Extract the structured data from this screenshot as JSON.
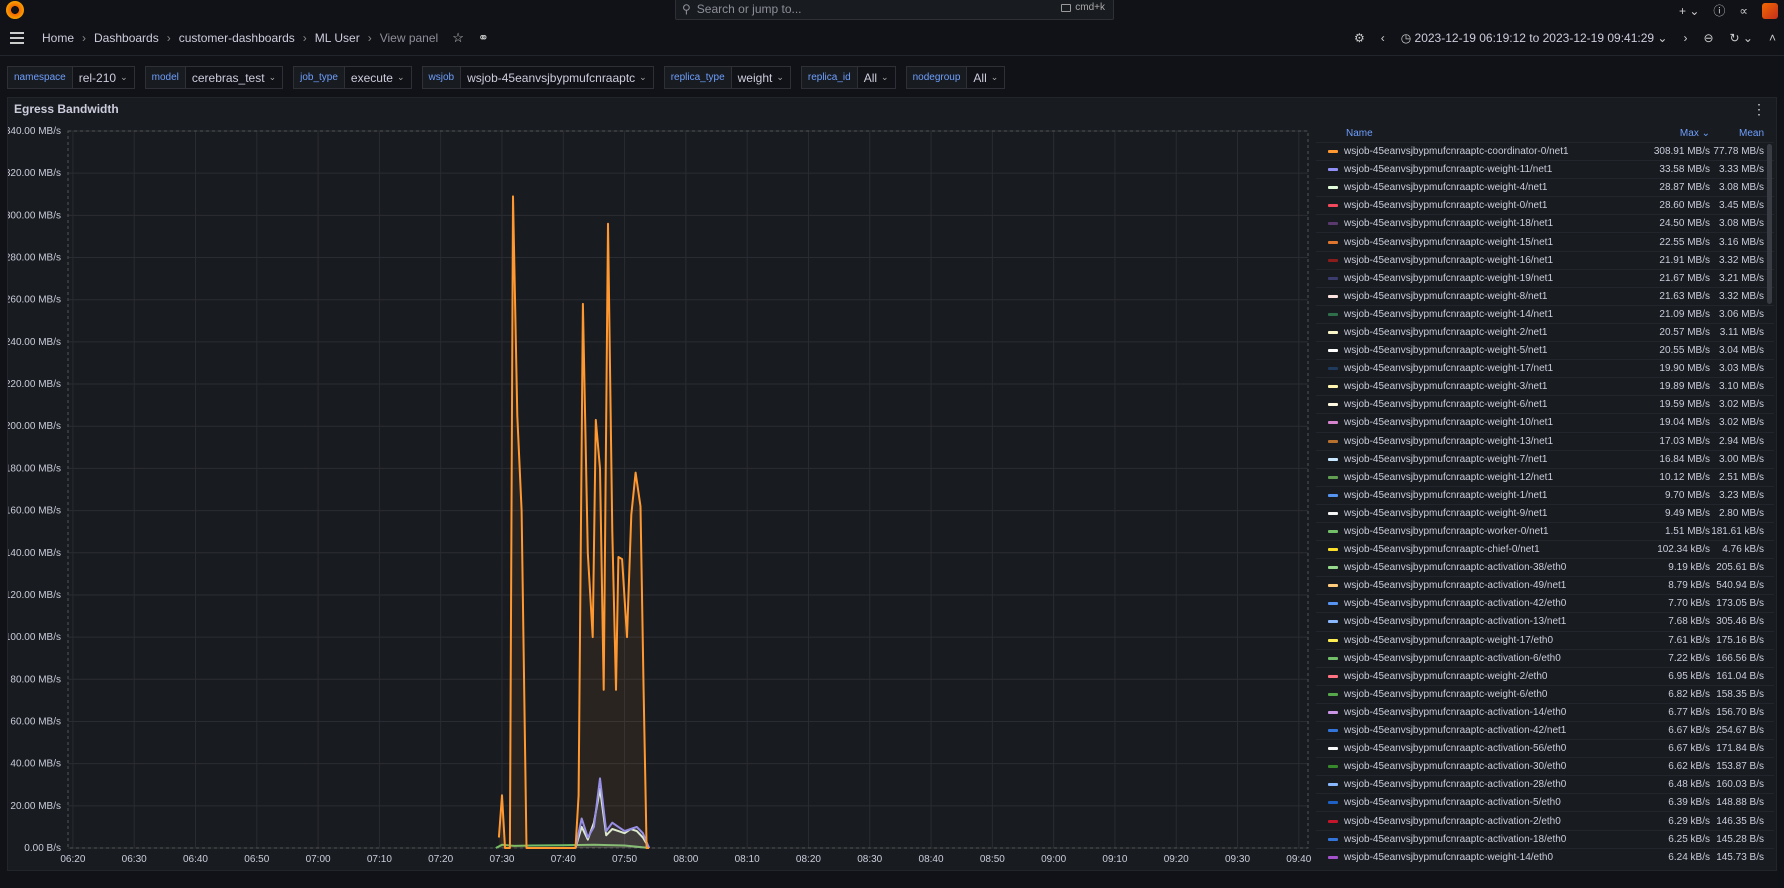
{
  "search": {
    "placeholder": "Search or jump to...",
    "shortcut": "cmd+k"
  },
  "breadcrumb": [
    "Home",
    "Dashboards",
    "customer-dashboards",
    "ML User",
    "View panel"
  ],
  "time_range": "2023-12-19 06:19:12 to 2023-12-19 09:41:29",
  "variables": [
    {
      "label": "namespace",
      "value": "rel-210"
    },
    {
      "label": "model",
      "value": "cerebras_test"
    },
    {
      "label": "job_type",
      "value": "execute"
    },
    {
      "label": "wsjob",
      "value": "wsjob-45eanvsjbypmufcnraaptc"
    },
    {
      "label": "replica_type",
      "value": "weight"
    },
    {
      "label": "replica_id",
      "value": "All"
    },
    {
      "label": "nodegroup",
      "value": "All"
    }
  ],
  "panel": {
    "title": "Egress Bandwidth"
  },
  "legend": {
    "headers": {
      "name": "Name",
      "max": "Max",
      "mean": "Mean"
    },
    "rows": [
      {
        "name": "wsjob-45eanvsjbypmufcnraaptc-coordinator-0/net1",
        "max": "308.91 MB/s",
        "mean": "77.78 MB/s",
        "color": "#ff9830"
      },
      {
        "name": "wsjob-45eanvsjbypmufcnraaptc-weight-11/net1",
        "max": "33.58 MB/s",
        "mean": "3.33 MB/s",
        "color": "#8f8ff5"
      },
      {
        "name": "wsjob-45eanvsjbypmufcnraaptc-weight-4/net1",
        "max": "28.87 MB/s",
        "mean": "3.08 MB/s",
        "color": "#e0f9d7"
      },
      {
        "name": "wsjob-45eanvsjbypmufcnraaptc-weight-0/net1",
        "max": "28.60 MB/s",
        "mean": "3.45 MB/s",
        "color": "#f2495c"
      },
      {
        "name": "wsjob-45eanvsjbypmufcnraaptc-weight-18/net1",
        "max": "24.50 MB/s",
        "mean": "3.08 MB/s",
        "color": "#5a3a6e"
      },
      {
        "name": "wsjob-45eanvsjbypmufcnraaptc-weight-15/net1",
        "max": "22.55 MB/s",
        "mean": "3.16 MB/s",
        "color": "#e0752d"
      },
      {
        "name": "wsjob-45eanvsjbypmufcnraaptc-weight-16/net1",
        "max": "21.91 MB/s",
        "mean": "3.32 MB/s",
        "color": "#8a1c1c"
      },
      {
        "name": "wsjob-45eanvsjbypmufcnraaptc-weight-19/net1",
        "max": "21.67 MB/s",
        "mean": "3.21 MB/s",
        "color": "#3b3b6e"
      },
      {
        "name": "wsjob-45eanvsjbypmufcnraaptc-weight-8/net1",
        "max": "21.63 MB/s",
        "mean": "3.32 MB/s",
        "color": "#fce2de"
      },
      {
        "name": "wsjob-45eanvsjbypmufcnraaptc-weight-14/net1",
        "max": "21.09 MB/s",
        "mean": "3.06 MB/s",
        "color": "#2e6e4a"
      },
      {
        "name": "wsjob-45eanvsjbypmufcnraaptc-weight-2/net1",
        "max": "20.57 MB/s",
        "mean": "3.11 MB/s",
        "color": "#f9f5c8"
      },
      {
        "name": "wsjob-45eanvsjbypmufcnraaptc-weight-5/net1",
        "max": "20.55 MB/s",
        "mean": "3.04 MB/s",
        "color": "#ffffff"
      },
      {
        "name": "wsjob-45eanvsjbypmufcnraaptc-weight-17/net1",
        "max": "19.90 MB/s",
        "mean": "3.03 MB/s",
        "color": "#1f3a5c"
      },
      {
        "name": "wsjob-45eanvsjbypmufcnraaptc-weight-3/net1",
        "max": "19.89 MB/s",
        "mean": "3.10 MB/s",
        "color": "#fff4b0"
      },
      {
        "name": "wsjob-45eanvsjbypmufcnraaptc-weight-6/net1",
        "max": "19.59 MB/s",
        "mean": "3.02 MB/s",
        "color": "#fff8e0"
      },
      {
        "name": "wsjob-45eanvsjbypmufcnraaptc-weight-10/net1",
        "max": "19.04 MB/s",
        "mean": "3.02 MB/s",
        "color": "#d683ce"
      },
      {
        "name": "wsjob-45eanvsjbypmufcnraaptc-weight-13/net1",
        "max": "17.03 MB/s",
        "mean": "2.94 MB/s",
        "color": "#b7702d"
      },
      {
        "name": "wsjob-45eanvsjbypmufcnraaptc-weight-7/net1",
        "max": "16.84 MB/s",
        "mean": "3.00 MB/s",
        "color": "#c8e6ff"
      },
      {
        "name": "wsjob-45eanvsjbypmufcnraaptc-weight-12/net1",
        "max": "10.12 MB/s",
        "mean": "2.51 MB/s",
        "color": "#629e51"
      },
      {
        "name": "wsjob-45eanvsjbypmufcnraaptc-weight-1/net1",
        "max": "9.70 MB/s",
        "mean": "3.23 MB/s",
        "color": "#5794f2"
      },
      {
        "name": "wsjob-45eanvsjbypmufcnraaptc-weight-9/net1",
        "max": "9.49 MB/s",
        "mean": "2.80 MB/s",
        "color": "#f4f4f4"
      },
      {
        "name": "wsjob-45eanvsjbypmufcnraaptc-worker-0/net1",
        "max": "1.51 MB/s",
        "mean": "181.61 kB/s",
        "color": "#73bf69"
      },
      {
        "name": "wsjob-45eanvsjbypmufcnraaptc-chief-0/net1",
        "max": "102.34 kB/s",
        "mean": "4.76 kB/s",
        "color": "#fade2a"
      },
      {
        "name": "wsjob-45eanvsjbypmufcnraaptc-activation-38/eth0",
        "max": "9.19 kB/s",
        "mean": "205.61 B/s",
        "color": "#96d98d"
      },
      {
        "name": "wsjob-45eanvsjbypmufcnraaptc-activation-49/net1",
        "max": "8.79 kB/s",
        "mean": "540.94 B/s",
        "color": "#ffcb7d"
      },
      {
        "name": "wsjob-45eanvsjbypmufcnraaptc-activation-42/eth0",
        "max": "7.70 kB/s",
        "mean": "173.05 B/s",
        "color": "#5794f2"
      },
      {
        "name": "wsjob-45eanvsjbypmufcnraaptc-activation-13/net1",
        "max": "7.68 kB/s",
        "mean": "305.46 B/s",
        "color": "#8ab8ff"
      },
      {
        "name": "wsjob-45eanvsjbypmufcnraaptc-weight-17/eth0",
        "max": "7.61 kB/s",
        "mean": "175.16 B/s",
        "color": "#ffee52"
      },
      {
        "name": "wsjob-45eanvsjbypmufcnraaptc-activation-6/eth0",
        "max": "7.22 kB/s",
        "mean": "166.56 B/s",
        "color": "#73bf69"
      },
      {
        "name": "wsjob-45eanvsjbypmufcnraaptc-weight-2/eth0",
        "max": "6.95 kB/s",
        "mean": "161.04 B/s",
        "color": "#ff7383"
      },
      {
        "name": "wsjob-45eanvsjbypmufcnraaptc-weight-6/eth0",
        "max": "6.82 kB/s",
        "mean": "158.35 B/s",
        "color": "#56a64b"
      },
      {
        "name": "wsjob-45eanvsjbypmufcnraaptc-activation-14/eth0",
        "max": "6.77 kB/s",
        "mean": "156.70 B/s",
        "color": "#ca95e5"
      },
      {
        "name": "wsjob-45eanvsjbypmufcnraaptc-activation-42/net1",
        "max": "6.67 kB/s",
        "mean": "254.67 B/s",
        "color": "#3274d9"
      },
      {
        "name": "wsjob-45eanvsjbypmufcnraaptc-activation-56/eth0",
        "max": "6.67 kB/s",
        "mean": "171.84 B/s",
        "color": "#f8f8f8"
      },
      {
        "name": "wsjob-45eanvsjbypmufcnraaptc-activation-30/eth0",
        "max": "6.62 kB/s",
        "mean": "153.87 B/s",
        "color": "#37872d"
      },
      {
        "name": "wsjob-45eanvsjbypmufcnraaptc-activation-28/eth0",
        "max": "6.48 kB/s",
        "mean": "160.03 B/s",
        "color": "#8ab8ff"
      },
      {
        "name": "wsjob-45eanvsjbypmufcnraaptc-activation-5/eth0",
        "max": "6.39 kB/s",
        "mean": "148.88 B/s",
        "color": "#1f60c4"
      },
      {
        "name": "wsjob-45eanvsjbypmufcnraaptc-activation-2/eth0",
        "max": "6.29 kB/s",
        "mean": "146.35 B/s",
        "color": "#c4162a"
      },
      {
        "name": "wsjob-45eanvsjbypmufcnraaptc-activation-18/eth0",
        "max": "6.25 kB/s",
        "mean": "145.28 B/s",
        "color": "#3274d9"
      },
      {
        "name": "wsjob-45eanvsjbypmufcnraaptc-weight-14/eth0",
        "max": "6.24 kB/s",
        "mean": "145.73 B/s",
        "color": "#a352cc"
      }
    ]
  },
  "chart_data": {
    "type": "line",
    "title": "Egress Bandwidth",
    "y_ticks": [
      "0.00 B/s",
      "20.00 MB/s",
      "40.00 MB/s",
      "60.00 MB/s",
      "80.00 MB/s",
      "100.00 MB/s",
      "120.00 MB/s",
      "140.00 MB/s",
      "160.00 MB/s",
      "180.00 MB/s",
      "200.00 MB/s",
      "220.00 MB/s",
      "240.00 MB/s",
      "260.00 MB/s",
      "280.00 MB/s",
      "300.00 MB/s",
      "320.00 MB/s",
      "340.00 MB/s"
    ],
    "x_ticks": [
      "06:20",
      "06:30",
      "06:40",
      "06:50",
      "07:00",
      "07:10",
      "07:20",
      "07:30",
      "07:40",
      "07:50",
      "08:00",
      "08:10",
      "08:20",
      "08:30",
      "08:40",
      "08:50",
      "09:00",
      "09:10",
      "09:20",
      "09:30",
      "09:40"
    ],
    "ylim": [
      0,
      340
    ],
    "xlim_minutes": [
      379.2,
      581.5
    ],
    "grid": true,
    "series": [
      {
        "name": "wsjob-45eanvsjbypmufcnraaptc-coordinator-0/net1",
        "color": "#ff9830",
        "points": [
          [
            449.5,
            5
          ],
          [
            450,
            25
          ],
          [
            450.5,
            0
          ],
          [
            451.3,
            0
          ],
          [
            451.8,
            309
          ],
          [
            452.5,
            205
          ],
          [
            453.2,
            160
          ],
          [
            454,
            0
          ],
          [
            462,
            0
          ],
          [
            462.5,
            25
          ],
          [
            463.2,
            258
          ],
          [
            464,
            140
          ],
          [
            464.8,
            100
          ],
          [
            465.3,
            203
          ],
          [
            466,
            180
          ],
          [
            466.6,
            75
          ],
          [
            467.3,
            296
          ],
          [
            468,
            150
          ],
          [
            468.6,
            75
          ],
          [
            469,
            138
          ],
          [
            469.6,
            137
          ],
          [
            470.4,
            100
          ],
          [
            471.1,
            158
          ],
          [
            471.8,
            178
          ],
          [
            472.6,
            162
          ],
          [
            473.1,
            75
          ],
          [
            473.6,
            0
          ],
          [
            474,
            0
          ]
        ]
      },
      {
        "name": "wsjob-45eanvsjbypmufcnraaptc-weight-11/net1",
        "color": "#8f8ff5",
        "points": [
          [
            462,
            0
          ],
          [
            463,
            14
          ],
          [
            464,
            5
          ],
          [
            465,
            10
          ],
          [
            466,
            33
          ],
          [
            467,
            8
          ],
          [
            468,
            12
          ],
          [
            469,
            10
          ],
          [
            470,
            8
          ],
          [
            471,
            9
          ],
          [
            472,
            10
          ],
          [
            473,
            7
          ],
          [
            474,
            0
          ]
        ]
      },
      {
        "name": "wsjob-45eanvsjbypmufcnraaptc-weight-4/net1",
        "color": "#e0f9d7",
        "points": [
          [
            462,
            0
          ],
          [
            463,
            10
          ],
          [
            464,
            4
          ],
          [
            465,
            12
          ],
          [
            466,
            28
          ],
          [
            467,
            6
          ],
          [
            468,
            9
          ],
          [
            469,
            8
          ],
          [
            470,
            7
          ],
          [
            471,
            9
          ],
          [
            472,
            8
          ],
          [
            473,
            5
          ],
          [
            474,
            0
          ]
        ]
      },
      {
        "name": "wsjob-45eanvsjbypmufcnraaptc-worker-0/net1",
        "color": "#73bf69",
        "points": [
          [
            449,
            0
          ],
          [
            450,
            1.5
          ],
          [
            452,
            1
          ],
          [
            455,
            1.2
          ],
          [
            460,
            1.3
          ],
          [
            465,
            1.5
          ],
          [
            470,
            1.2
          ],
          [
            474,
            0
          ]
        ]
      }
    ]
  },
  "colors": {
    "accent": "#6e9fff",
    "background": "#111217",
    "panel": "#181b1f"
  },
  "icons": [
    "grafana-logo-icon",
    "search-icon",
    "plus-icon",
    "help-icon",
    "rss-icon",
    "avatar",
    "menu-icon",
    "star-icon",
    "share-icon",
    "settings-icon",
    "chevron-left-icon",
    "clock-icon",
    "chevron-right-icon",
    "zoom-out-icon",
    "refresh-icon",
    "collapse-icon",
    "panel-menu-icon"
  ]
}
